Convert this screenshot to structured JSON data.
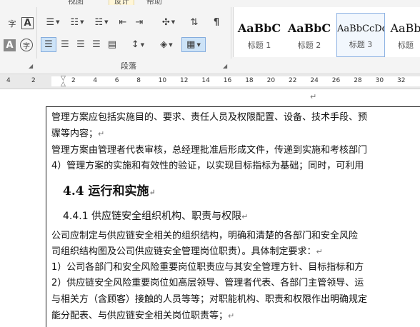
{
  "ribbon": {
    "tabs": [
      "视图",
      "设计",
      "帮助"
    ],
    "font_tools": {
      "phonetic": "字",
      "border": "A",
      "shade": "A",
      "enclose": "字"
    },
    "group_label": "段落",
    "styles": [
      {
        "sample": "AaBbC",
        "name": "标题 1"
      },
      {
        "sample": "AaBbC",
        "name": "标题 2"
      },
      {
        "sample": "AaBbCcDd",
        "name": "标题 3"
      },
      {
        "sample": "AaBb",
        "name": "标题"
      }
    ]
  },
  "ruler": {
    "left_numbers": [
      "4",
      "2"
    ],
    "numbers": [
      "2",
      "4",
      "6",
      "8",
      "10",
      "12",
      "14",
      "16",
      "18",
      "20",
      "22",
      "24",
      "26",
      "28",
      "30",
      "32",
      "34"
    ]
  },
  "document": {
    "lines": [
      "管理方案应包括实施目的、要求、责任人员及权限配置、设备、技术手段、预",
      "骤等内容；",
      "管理方案由管理者代表审核，总经理批准后形成文件，传递到实施和考核部门",
      "4）管理方案的实施和有效性的验证，以实现目标指标为基础；同时，可利用"
    ],
    "heading2": "4.4  运行和实施",
    "heading3": "4.4.1  供应链安全组织机构、职责与权限",
    "body": [
      "  公司应制定与供应链安全相关的组织结构，明确和清楚的各部门和安全风险",
      "司组织结构图及公司供应链安全管理岗位职责）。具体制定要求：",
      "1）公司各部门和安全风险重要岗位职责应与其安全管理方针、目标指标和方",
      "2）供应链安全风险重要岗位如高层领导、管理者代表、各部门主管领导、运",
      "与相关方（含顾客）接触的人员等等；对职能机构、职责和权限作出明确规定",
      "能分配表、与供应链安全相关岗位职责等；"
    ]
  }
}
